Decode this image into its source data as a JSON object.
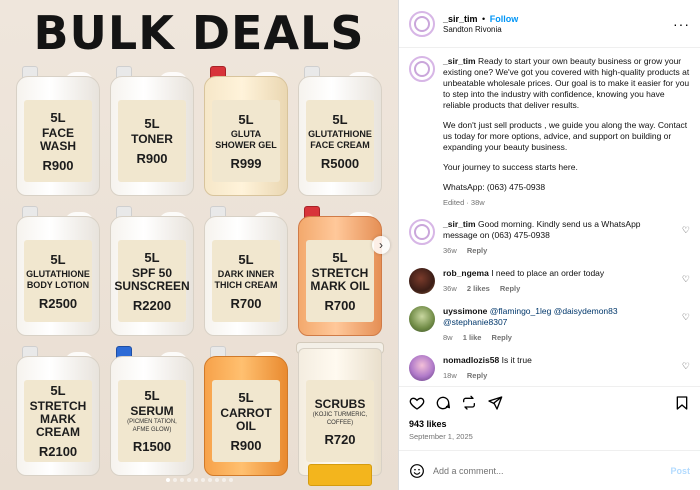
{
  "media": {
    "title": "BULK DEALS",
    "products": [
      {
        "size": "5L",
        "name": "FACE\nWASH",
        "price": "R900",
        "cap": "white",
        "style": "plain",
        "small": false
      },
      {
        "size": "5L",
        "name": "TONER",
        "price": "R900",
        "cap": "white",
        "style": "plain",
        "small": false
      },
      {
        "size": "5L",
        "name": "GLUTA\nSHOWER GEL",
        "price": "R999",
        "cap": "red",
        "style": "cream",
        "small": true
      },
      {
        "size": "5L",
        "name": "GLUTATHIONE\nFACE CREAM",
        "price": "R5000",
        "cap": "white",
        "style": "plain",
        "small": true
      },
      {
        "size": "5L",
        "name": "GLUTATHIONE\nBODY LOTION",
        "price": "R2500",
        "cap": "white",
        "style": "plain",
        "small": true
      },
      {
        "size": "5L",
        "name": "SPF 50\nSUNSCREEN",
        "price": "R2200",
        "cap": "white",
        "style": "plain",
        "small": false
      },
      {
        "size": "5L",
        "name": "DARK INNER\nTHICH CREAM",
        "price": "R700",
        "cap": "white",
        "style": "plain",
        "small": true
      },
      {
        "size": "5L",
        "name": "STRETCH\nMARK OIL",
        "price": "R700",
        "cap": "red",
        "style": "peach",
        "small": false
      },
      {
        "size": "5L",
        "name": "STRETCH\nMARK CREAM",
        "price": "R2100",
        "cap": "white",
        "style": "plain",
        "small": false
      },
      {
        "size": "5L",
        "name": "SERUM",
        "sub": "(PICMEN TATION,\nAFME GLOW)",
        "price": "R1500",
        "cap": "blue",
        "style": "plain",
        "small": false
      },
      {
        "size": "5L",
        "name": "CARROT\nOIL",
        "price": "R900",
        "cap": "white",
        "style": "amber",
        "small": false
      },
      {
        "size": "",
        "name": "SCRUBS",
        "sub": "(KOJIC TURMERIC,\nCOFFEE)",
        "price": "R720",
        "cap": "none",
        "style": "tub",
        "small": false
      }
    ],
    "slide_count": 10,
    "active_slide": 1
  },
  "header": {
    "username": "_sir_tim",
    "separator": "•",
    "follow_label": "Follow",
    "location": "Sandton Rivonia",
    "more_icon": "more-horizontal-icon"
  },
  "caption": {
    "username": "_sir_tim",
    "p1": "Ready to start your own beauty business or grow your existing one? We've got you covered with high-quality products at unbeatable wholesale prices. Our goal is to make it easier for you to step into the industry with confidence, knowing you have reliable products that deliver results.",
    "p2": "We don't just sell products , we guide you along the way. Contact us today for more options, advice, and support on building or expanding your beauty business.",
    "p3": "Your journey to success starts here.",
    "p4": "WhatsApp: (063) 475-0938",
    "edited": "Edited · 38w"
  },
  "comments": [
    {
      "username": "_sir_tim",
      "text": "Good morning. Kindly send us a WhatsApp message on (063) 475-0938",
      "age": "36w",
      "likes": "",
      "reply": "Reply",
      "avatar": "brand"
    },
    {
      "username": "rob_ngema",
      "text": "I need to place an order today",
      "age": "36w",
      "likes": "2 likes",
      "reply": "Reply",
      "avatar": "rob"
    },
    {
      "username": "uyssimone",
      "mentions": "@flamingo_1leg @daisydemon83 @stephanie8307",
      "age": "8w",
      "likes": "1 like",
      "reply": "Reply",
      "avatar": "uy"
    },
    {
      "username": "nomadlozis58",
      "text": "Is it true",
      "age": "18w",
      "likes": "",
      "reply": "Reply",
      "avatar": "nom"
    }
  ],
  "footer": {
    "likes": "943 likes",
    "date": "September 1, 2025",
    "comment_placeholder": "Add a comment...",
    "post_label": "Post"
  },
  "colors": {
    "follow": "#0095f6",
    "post_disabled": "#b3dbff",
    "muted": "#737373"
  }
}
